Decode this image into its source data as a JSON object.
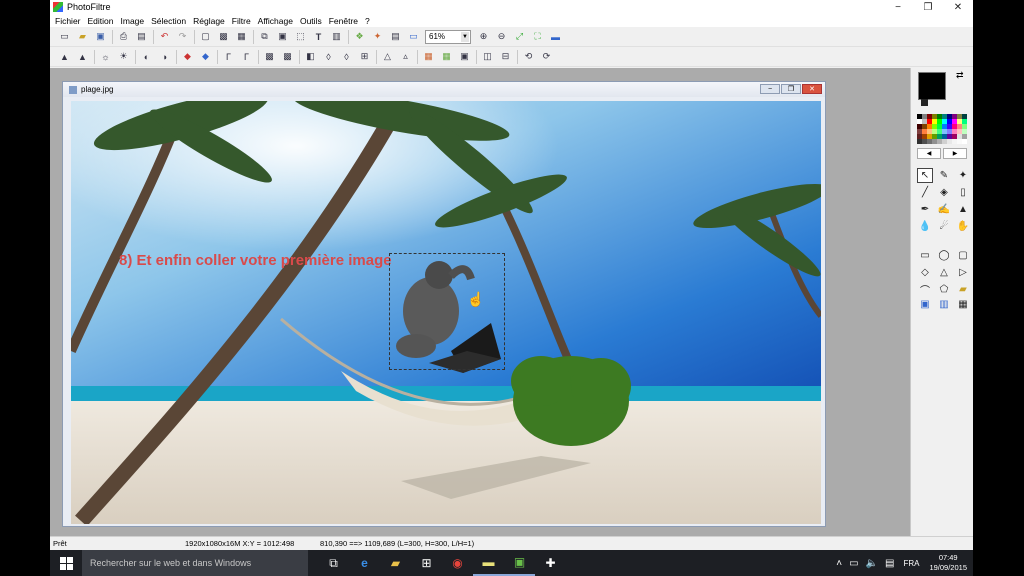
{
  "window": {
    "title": "PhotoFiltre",
    "minimize_glyph": "−",
    "maximize_glyph": "❐",
    "close_glyph": "✕"
  },
  "menu": [
    "Fichier",
    "Edition",
    "Image",
    "Sélection",
    "Réglage",
    "Filtre",
    "Affichage",
    "Outils",
    "Fenêtre",
    "?"
  ],
  "toolbar": {
    "zoom_value": "61%"
  },
  "document": {
    "title": "plage.jpg",
    "overlay_text": "8) Et enfin coller votre première image"
  },
  "status": {
    "ready": "Prêt",
    "image_info": "1920x1080x16M     X:Y = 1012:498",
    "selection_info": "810,390 ==> 1109,689 (L=300, H=300, L/H=1)"
  },
  "taskbar": {
    "search_placeholder": "Rechercher sur le web et dans Windows",
    "language": "FRA",
    "time": "07:49",
    "date": "19/09/2015"
  },
  "colors": {
    "foreground": "#000000",
    "background": "#ffffff",
    "overlay_text": "#d94a4a",
    "taskbar": "#1d1f24"
  },
  "palette_swatches": [
    "#000000",
    "#808080",
    "#800000",
    "#808000",
    "#008000",
    "#008080",
    "#000080",
    "#800080",
    "#808040",
    "#004040",
    "#ffffff",
    "#c0c0c0",
    "#ff0000",
    "#ffff00",
    "#00ff00",
    "#00ffff",
    "#0000ff",
    "#ff00ff",
    "#ffff80",
    "#00ff80",
    "#400000",
    "#804000",
    "#ff8000",
    "#80ff00",
    "#00ff40",
    "#0080ff",
    "#4000ff",
    "#ff0080",
    "#ff8080",
    "#80ff80",
    "#804040",
    "#ff8040",
    "#ffc080",
    "#c0ff80",
    "#40ff80",
    "#80c0ff",
    "#8080ff",
    "#ff80c0",
    "#ffc0c0",
    "#c0ffc0",
    "#602020",
    "#a04000",
    "#e0a000",
    "#60a000",
    "#00a060",
    "#0060a0",
    "#6000a0",
    "#a00060",
    "#e0e0e0",
    "#a0a0a0",
    "#303030",
    "#505050",
    "#707070",
    "#909090",
    "#b0b0b0",
    "#d0d0d0",
    "#e8e8e8",
    "#f4f4f4",
    "#fafafa",
    "#ffffff"
  ]
}
